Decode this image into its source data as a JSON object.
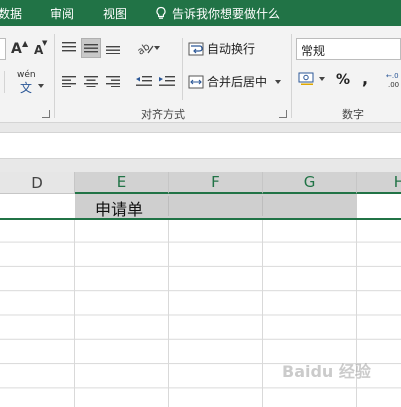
{
  "ribbon_tabs": [
    {
      "label": "数据"
    },
    {
      "label": "审阅"
    },
    {
      "label": "视图"
    }
  ],
  "tell_me": "告诉我你想要做什么",
  "alignment_group": {
    "wrap_text": "自动换行",
    "merge_center": "合并后居中",
    "label": "对齐方式"
  },
  "number_group": {
    "format": "常规",
    "percent": "%",
    "comma": ",",
    "label": "数字"
  },
  "font_group": {
    "grow": "A",
    "shrink": "A",
    "phonetic": "wén"
  },
  "columns": [
    "D",
    "E",
    "F",
    "G",
    "H"
  ],
  "cells": {
    "E1": "申请单"
  },
  "watermark": "Baidu 经验",
  "colors": {
    "accent": "#217346",
    "ribbon_bg": "#f3f3f3",
    "selected_fill": "#cfcfcf"
  }
}
